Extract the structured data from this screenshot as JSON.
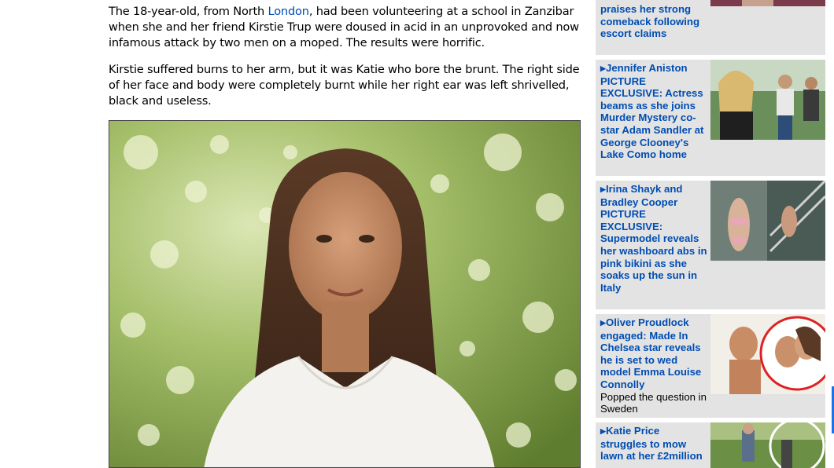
{
  "article": {
    "p1_a": "The 18-year-old, from North ",
    "p1_link": "London",
    "p1_b": ", had been volunteering at a school in Zanzibar when she and her friend Kirstie Trup were doused in acid in an unprovoked and now infamous attack by two men on a moped. The results were horrific.",
    "p2": "Kirstie suffered burns to her arm, but it was Katie who bore the brunt. The right side of her face and body were completely burnt while her right ear was left shrivelled, black and useless."
  },
  "sidebar": {
    "items": [
      {
        "title": "praises her strong comeback following escort claims",
        "thumb": "red-carpet-thumb"
      },
      {
        "title": "Jennifer Aniston PICTURE EXCLUSIVE: Actress beams as she joins Murder Mystery co-star Adam Sandler at George Clooney's Lake Como home",
        "thumb": "aniston-thumb"
      },
      {
        "title": "Irina Shayk and Bradley Cooper PICTURE EXCLUSIVE: Supermodel reveals her washboard abs  in pink bikini as she soaks up the sun in Italy",
        "thumb": "bikini-thumb"
      },
      {
        "title": "Oliver Proudlock engaged: Made In Chelsea star reveals he is set to wed model Emma Louise Connolly",
        "subtitle": "Popped the question in Sweden",
        "thumb": "couple-thumb"
      },
      {
        "title": "Katie Price struggles to mow lawn at her £2million",
        "thumb": "lawn-thumb"
      }
    ],
    "accent": "#004db3",
    "card_bg": "#e3e3e3"
  }
}
